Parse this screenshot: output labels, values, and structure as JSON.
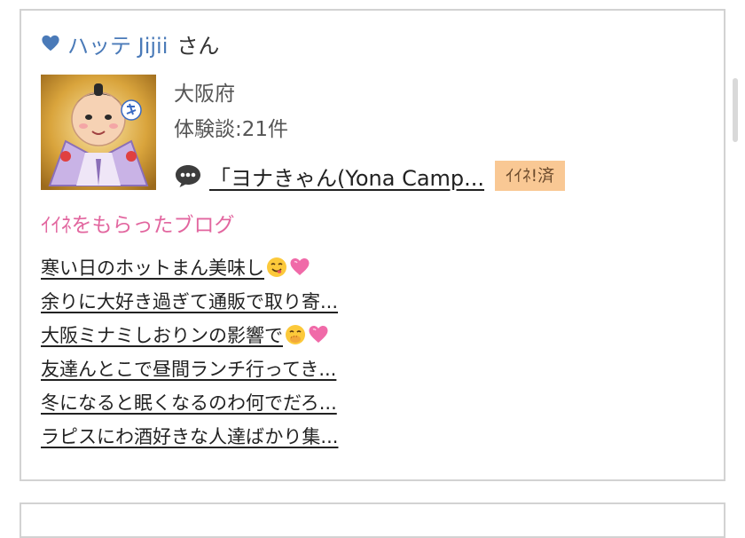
{
  "profile": {
    "name": "ハッテ Jijii",
    "honorific": "さん",
    "prefecture": "大阪府",
    "experience_count": "体験談:21件",
    "latest_comment": "「ヨナきゃん(Yona Camp...",
    "like_badge": "ｲｲﾈ!済",
    "avatar_icon": "fortune-doll-avatar"
  },
  "liked_blogs": {
    "title": "ｲｲﾈをもらったブログ",
    "items": [
      {
        "text": "寒い日のホットまん美味し",
        "emojis": [
          "yum-face",
          "pink-heart"
        ]
      },
      {
        "text": "余りに大好き過ぎて通販で取り寄...",
        "emojis": []
      },
      {
        "text": "大阪ミナミしおりンの影響で",
        "emojis": [
          "hand-over-mouth-face",
          "pink-heart"
        ]
      },
      {
        "text": "友達んとこで昼間ランチ行ってき...",
        "emojis": []
      },
      {
        "text": "冬になると眠くなるのわ何でだろ...",
        "emojis": []
      },
      {
        "text": "ラピスにわ酒好きな人達ばかり集...",
        "emojis": []
      }
    ]
  },
  "colors": {
    "name_blue": "#4a7ab8",
    "section_pink": "#e2669f",
    "badge_bg": "#f9c894",
    "border": "#d2d2d2"
  }
}
